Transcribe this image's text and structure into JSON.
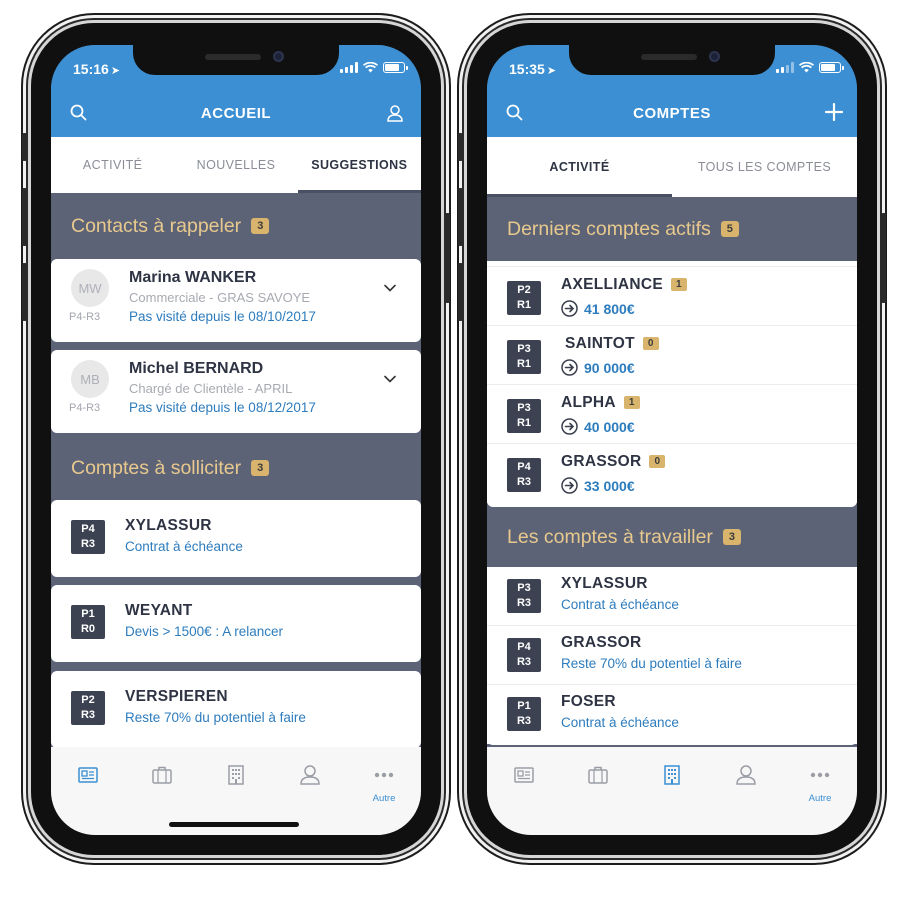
{
  "left": {
    "status": {
      "time": "15:16"
    },
    "header": {
      "title": "ACCUEIL"
    },
    "tabs": [
      {
        "label": "ACTIVITÉ"
      },
      {
        "label": "NOUVELLES"
      },
      {
        "label": "SUGGESTIONS"
      }
    ],
    "contacts_section": {
      "title": "Contacts à rappeler",
      "count": "3"
    },
    "contacts": [
      {
        "initials": "MW",
        "level": "P4-R3",
        "name": "Marina WANKER",
        "subtitle": "Commerciale  - GRAS SAVOYE",
        "note": "Pas visité depuis le 08/10/2017"
      },
      {
        "initials": "MB",
        "level": "P4-R3",
        "name": "Michel BERNARD",
        "subtitle": "Chargé de Clientèle  - APRIL",
        "note": "Pas visité depuis le 08/12/2017"
      }
    ],
    "accounts_section": {
      "title": "Comptes à solliciter",
      "count": "3"
    },
    "accounts": [
      {
        "p": "P4",
        "r": "R3",
        "name": "XYLASSUR",
        "detail": "Contrat à échéance"
      },
      {
        "p": "P1",
        "r": "R0",
        "name": "WEYANT",
        "detail": "Devis > 1500€ : A relancer"
      },
      {
        "p": "P2",
        "r": "R3",
        "name": "VERSPIEREN",
        "detail": "Reste 70% du potentiel à faire"
      }
    ],
    "nav": {
      "more_label": "Autre"
    }
  },
  "right": {
    "status": {
      "time": "15:35"
    },
    "header": {
      "title": "COMPTES"
    },
    "tabs": [
      {
        "label": "ACTIVITÉ"
      },
      {
        "label": "TOUS LES COMPTES"
      }
    ],
    "recent_section": {
      "title": "Derniers comptes actifs",
      "count": "5"
    },
    "recent_accounts": [
      {
        "p": "P2",
        "r": "R1",
        "name": "AXELLIANCE",
        "badge": "1",
        "amount": "41 800€"
      },
      {
        "p": "P3",
        "r": "R1",
        "name": "SAINTOT",
        "badge": "0",
        "amount": "90 000€"
      },
      {
        "p": "P3",
        "r": "R1",
        "name": "ALPHA",
        "badge": "1",
        "amount": "40 000€"
      },
      {
        "p": "P4",
        "r": "R3",
        "name": "GRASSOR",
        "badge": "0",
        "amount": "33 000€"
      }
    ],
    "work_section": {
      "title": "Les comptes à travailler",
      "count": "3"
    },
    "work_accounts": [
      {
        "p": "P3",
        "r": "R3",
        "name": "XYLASSUR",
        "detail": "Contrat à échéance"
      },
      {
        "p": "P4",
        "r": "R3",
        "name": "GRASSOR",
        "detail": "Reste 70% du potentiel à faire"
      },
      {
        "p": "P1",
        "r": "R3",
        "name": "FOSER",
        "detail": "Contrat à échéance"
      }
    ],
    "nav": {
      "more_label": "Autre"
    }
  },
  "colors": {
    "header_blue": "#3b8fd2",
    "section_bg": "#5d6377",
    "section_title": "#e8c98d",
    "count_badge": "#d8b46c",
    "link_blue": "#2d7cbd",
    "pr_badge": "#3d4252"
  },
  "icons": {
    "header": [
      "search-icon",
      "user-icon",
      "plus-icon"
    ],
    "row": [
      "chevron-down-icon",
      "arrow-right-circle-icon"
    ],
    "nav": [
      "newspaper-icon",
      "briefcase-icon",
      "building-icon",
      "person-icon",
      "more-dots-icon"
    ]
  }
}
